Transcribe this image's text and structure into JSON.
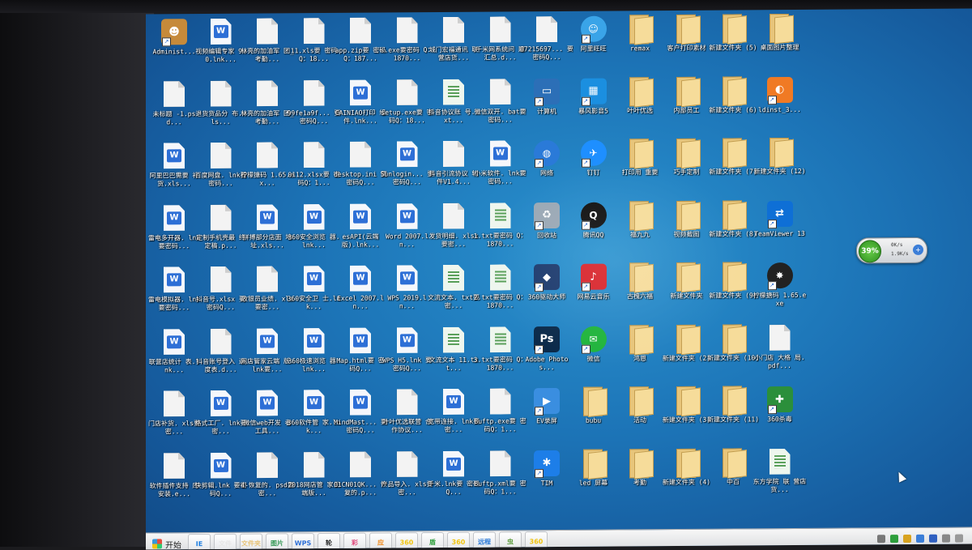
{
  "desktop": {
    "icons": [
      {
        "label": "Administ...",
        "kind": "user"
      },
      {
        "label": "视频编辑专家 9.0.lnk...",
        "kind": "wps"
      },
      {
        "label": "林亮的加油军 团_考勤...",
        "kind": "doc"
      },
      {
        "label": "11.xls要 密码Q：18...",
        "kind": "doc"
      },
      {
        "label": "app.zip要 密码Q：187...",
        "kind": "doc"
      },
      {
        "label": "s.exe要密码 Q：1870...",
        "kind": "doc"
      },
      {
        "label": "城门宏福通讯 联营店货...",
        "kind": "doc"
      },
      {
        "label": "千米网系统问 题汇总.d...",
        "kind": "doc"
      },
      {
        "label": "07215697... 要密码Q...",
        "kind": "doc"
      },
      {
        "label": "阿里旺旺",
        "kind": "ww"
      },
      {
        "label": "remax",
        "kind": "folder"
      },
      {
        "label": "客户打印素材",
        "kind": "folder"
      },
      {
        "label": "新建文件夹 (5)",
        "kind": "folder"
      },
      {
        "label": "桌面图片整理",
        "kind": "folder"
      },
      {
        "label": "未标题 -1.psd...",
        "kind": "doc"
      },
      {
        "label": "退货货品分 布.xls...",
        "kind": "doc"
      },
      {
        "label": "林亮的加油军 团_考勤...",
        "kind": "doc"
      },
      {
        "label": "99fe1a9f... 要密码Q...",
        "kind": "doc"
      },
      {
        "label": "CAINIAO打印 组件.lnk...",
        "kind": "wps"
      },
      {
        "label": "setup.exe要 密码Q：18...",
        "kind": "doc"
      },
      {
        "label": "抖音协议账 号.txt...",
        "kind": "txt"
      },
      {
        "label": "微信双开. bat要密码...",
        "kind": "doc"
      },
      {
        "label": "计算机",
        "kind": "pc"
      },
      {
        "label": "暴风影音5",
        "kind": "bf"
      },
      {
        "label": "叶叶优选",
        "kind": "folder"
      },
      {
        "label": "内部员工",
        "kind": "folder"
      },
      {
        "label": "新建文件夹 (6)",
        "kind": "folder"
      },
      {
        "label": "ldinst_3...",
        "kind": "ld"
      },
      {
        "label": "阿里巴巴需要 补货.xls...",
        "kind": "wps"
      },
      {
        "label": "百度网盘. lnk要密码...",
        "kind": "doc"
      },
      {
        "label": "柠檬搪码 1.65.ex...",
        "kind": "doc"
      },
      {
        "label": "0112.xlsx要 密码Q：1...",
        "kind": "doc"
      },
      {
        "label": "desktop.ini 要密码Q...",
        "kind": "doc"
      },
      {
        "label": "Sunlogin... 要密码Q...",
        "kind": "wps"
      },
      {
        "label": "抖音引流协议 软件V1.4...",
        "kind": "doc"
      },
      {
        "label": "小米软件. lnk要密码...",
        "kind": "wps"
      },
      {
        "label": "网络",
        "kind": "net"
      },
      {
        "label": "钉钉",
        "kind": "dd"
      },
      {
        "label": "打印用 重要",
        "kind": "folder"
      },
      {
        "label": "巧手定制",
        "kind": "folder"
      },
      {
        "label": "新建文件夹 (7)",
        "kind": "folder"
      },
      {
        "label": "新建文件夹 (12)",
        "kind": "folder"
      },
      {
        "label": "雷电多开器. lnk要密码...",
        "kind": "wps"
      },
      {
        "label": "定制手机壳最 终定稿.p...",
        "kind": "doc"
      },
      {
        "label": "拼搏部分店面 地址.xls...",
        "kind": "wps"
      },
      {
        "label": "360安全浏览 器.lnk...",
        "kind": "wps"
      },
      {
        "label": "esAPI(云端 版).lnk...",
        "kind": "wps"
      },
      {
        "label": "Word 2007.ln...",
        "kind": "wps"
      },
      {
        "label": "发货明细. xlsx要密...",
        "kind": "doc"
      },
      {
        "label": "1.txt要密码 Q：1870...",
        "kind": "txt"
      },
      {
        "label": "回收站",
        "kind": "bin"
      },
      {
        "label": "腾讯QQ",
        "kind": "qq"
      },
      {
        "label": "福九九",
        "kind": "folder"
      },
      {
        "label": "视频截图",
        "kind": "folder"
      },
      {
        "label": "新建文件夹 (8)",
        "kind": "folder"
      },
      {
        "label": "TeamViewer 13",
        "kind": "tv"
      },
      {
        "label": "雷电模拟器. lnk要密码...",
        "kind": "wps"
      },
      {
        "label": "抖音号.xlsx 要密码Q...",
        "kind": "doc"
      },
      {
        "label": "收银员业绩. xls要密...",
        "kind": "doc"
      },
      {
        "label": "360安全卫 士.lnk...",
        "kind": "wps"
      },
      {
        "label": "Excel 2007.ln...",
        "kind": "wps"
      },
      {
        "label": "WPS 2019.ln...",
        "kind": "wps"
      },
      {
        "label": "文流文本. txt要密...",
        "kind": "txt"
      },
      {
        "label": "2.txt要密码 Q：1870...",
        "kind": "txt"
      },
      {
        "label": "360驱动大师",
        "kind": "q360"
      },
      {
        "label": "网易云音乐",
        "kind": "163"
      },
      {
        "label": "古槐六福",
        "kind": "folder"
      },
      {
        "label": "新建文件夹",
        "kind": "folder"
      },
      {
        "label": "新建文件夹 (9)",
        "kind": "folder"
      },
      {
        "label": "柠檬搪码 1.65.exe",
        "kind": "wheel"
      },
      {
        "label": "联营店统计 表.lnk...",
        "kind": "wps"
      },
      {
        "label": "抖音账号登入 进度表.d...",
        "kind": "doc"
      },
      {
        "label": "网店管家云端 版.lnk要...",
        "kind": "wps"
      },
      {
        "label": "360极速浏览 器.lnk...",
        "kind": "wps"
      },
      {
        "label": "Map.html要 密码Q...",
        "kind": "wps"
      },
      {
        "label": "WPS H5.lnk 要密码Q...",
        "kind": "wps"
      },
      {
        "label": "文流文本 11.txt...",
        "kind": "txt"
      },
      {
        "label": "3.txt要密码 Q：1870...",
        "kind": "txt"
      },
      {
        "label": "Adobe Photos...",
        "kind": "ps"
      },
      {
        "label": "微信",
        "kind": "wx"
      },
      {
        "label": "鸿恩",
        "kind": "folder"
      },
      {
        "label": "新建文件夹 (2)",
        "kind": "folder"
      },
      {
        "label": "新建文件夹 (10)",
        "kind": "folder"
      },
      {
        "label": "小门店 大格 局.pdf...",
        "kind": "doc"
      },
      {
        "label": "门店补货. xls要密...",
        "kind": "doc"
      },
      {
        "label": "格式工厂. lnk要密...",
        "kind": "wps"
      },
      {
        "label": "微信web开发 者工具...",
        "kind": "wps"
      },
      {
        "label": "360软件管 家.lnk...",
        "kind": "wps"
      },
      {
        "label": "MindMast... 要密码Q...",
        "kind": "wps"
      },
      {
        "label": "叶叶优选联营 合作协议...",
        "kind": "doc"
      },
      {
        "label": "宽带连接. lnk要密...",
        "kind": "wps"
      },
      {
        "label": "Buftp.exe要 密码Q：1...",
        "kind": "doc"
      },
      {
        "label": "EV录屏",
        "kind": "ev"
      },
      {
        "label": "bubu",
        "kind": "folder"
      },
      {
        "label": "活动",
        "kind": "folder"
      },
      {
        "label": "新建文件夹 (3)",
        "kind": "folder"
      },
      {
        "label": "新建文件夹 (11)",
        "kind": "folder"
      },
      {
        "label": "360杀毒",
        "kind": "sd"
      },
      {
        "label": "软件插件支持 库安装.e...",
        "kind": "doc"
      },
      {
        "label": "快剪辑.lnk 要密码Q...",
        "kind": "wps"
      },
      {
        "label": "4-恢复的. psd要密...",
        "kind": "doc"
      },
      {
        "label": "2018网店管 家云端版...",
        "kind": "doc"
      },
      {
        "label": "O1CN01QK... 恢复的.p...",
        "kind": "doc"
      },
      {
        "label": "产品导入. xls要密...",
        "kind": "doc"
      },
      {
        "label": "千米.lnk要 密码Q...",
        "kind": "wps"
      },
      {
        "label": "Buftp.xml要 密码Q：1...",
        "kind": "doc"
      },
      {
        "label": "TIM",
        "kind": "tim"
      },
      {
        "label": "led 屏幕",
        "kind": "folder"
      },
      {
        "label": "考勤",
        "kind": "folder"
      },
      {
        "label": "新建文件夹 (4)",
        "kind": "folder"
      },
      {
        "label": "中百",
        "kind": "folder"
      },
      {
        "label": "东方学院 联 营店货...",
        "kind": "xls"
      }
    ]
  },
  "widget": {
    "percent": "39%",
    "up": "0K/s",
    "down": "1.9K/s"
  },
  "taskbar": {
    "start_label": "开始",
    "items": [
      "IE",
      "文件",
      "文件夹",
      "图片",
      "WPS",
      "轮",
      "彩",
      "应",
      "360",
      "盾",
      "360",
      "远程",
      "虫",
      "360"
    ]
  },
  "colors": {
    "desktop": "#1c73b6",
    "folder": "#f6dc9a",
    "wps_blue": "#2d6fd6"
  }
}
